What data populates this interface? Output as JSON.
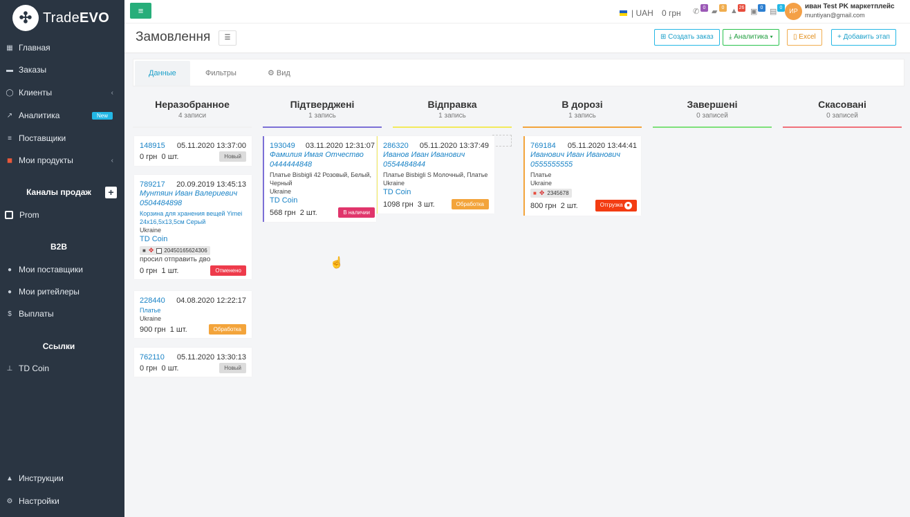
{
  "app": {
    "logo_glyph": "✣",
    "logo_text_1": "Trade",
    "logo_text_2": "EVO"
  },
  "sidebar": {
    "items": [
      {
        "label": "Главная",
        "icon": "dashboard-icon"
      },
      {
        "label": "Заказы",
        "icon": "truck-icon"
      },
      {
        "label": "Клиенты",
        "icon": "user-icon"
      },
      {
        "label": "Аналитика",
        "icon": "chart-icon",
        "badge": "New"
      },
      {
        "label": "Поставщики",
        "icon": "list-icon"
      },
      {
        "label": "Мои продукты",
        "icon": "box-icon"
      }
    ],
    "sales_channels_heading": "Каналы продаж",
    "prom_label": "Prom",
    "b2b_heading": "B2B",
    "b2b_items": [
      {
        "label": "Мои поставщики"
      },
      {
        "label": "Мои ритейлеры"
      },
      {
        "label": "Выплаты"
      }
    ],
    "links_heading": "Ссылки",
    "td_coin_label": "TD Coin",
    "instructions_label": "Инструкции",
    "settings_label": "Настройки"
  },
  "topbar": {
    "currency": "| UAH",
    "balance": "0 грн",
    "counters": [
      {
        "icon": "phone-icon",
        "count": "0",
        "color": "#9b59b6"
      },
      {
        "icon": "chat-icon",
        "count": "0",
        "color": "#f0ad4e"
      },
      {
        "icon": "bell-icon",
        "count": "26",
        "color": "#e74c3c"
      },
      {
        "icon": "bag-icon",
        "count": "0",
        "color": "#2c7fd1"
      },
      {
        "icon": "cart-icon",
        "count": "0",
        "color": "#23b7e5"
      }
    ],
    "avatar_initials": "ИР",
    "user_name": "иван Test PK маркетплейс",
    "user_email": "muntiyan@gmail.com"
  },
  "header": {
    "title": "Замовлення",
    "create_order": "Создать заказ",
    "analytics": "Аналитика",
    "excel": "Excel",
    "add_stage": "Добавить этап"
  },
  "tabs": {
    "data": "Данные",
    "filters": "Фильтры",
    "view": "Вид"
  },
  "columns": [
    {
      "title": "Неразобранное",
      "count": "4 записи",
      "color": "#f1f1f1"
    },
    {
      "title": "Підтверджені",
      "count": "1 запись",
      "color": "#7b6fd6"
    },
    {
      "title": "Відправка",
      "count": "1 запись",
      "color": "#f3ea5b"
    },
    {
      "title": "В дорозі",
      "count": "1 запись",
      "color": "#f3a43b"
    },
    {
      "title": "Завершені",
      "count": "0 записей",
      "color": "#7ee07a"
    },
    {
      "title": "Скасовані",
      "count": "0 записей",
      "color": "#f0707a"
    }
  ],
  "cards": {
    "c148915": {
      "id": "148915",
      "date": "05.11.2020 13:37:00",
      "sum": "0 грн",
      "qty": "0 шт.",
      "status": "Новый"
    },
    "c789217": {
      "id": "789217",
      "date": "20.09.2019 13:45:13",
      "name": "Мунтяин Иван Валериевич",
      "phone": "0504484898",
      "product": "Корзина для хранения вещей Yimei 24х16,5х13,5см Серый",
      "country": "Ukraine",
      "shop": "TD Coin",
      "ttn": "20450165624306",
      "comment": "просил отправить дво",
      "sum": "0 грн",
      "qty": "1 шт.",
      "status": "Отменено"
    },
    "c228440": {
      "id": "228440",
      "date": "04.08.2020 12:22:17",
      "product": "Платье",
      "country": "Ukraine",
      "sum": "900 грн",
      "qty": "1 шт.",
      "status": "Обработка"
    },
    "c762110": {
      "id": "762110",
      "date": "05.11.2020 13:30:13",
      "sum": "0 грн",
      "qty": "0 шт.",
      "status": "Новый"
    },
    "c193049": {
      "id": "193049",
      "date": "03.11.2020 12:31:07",
      "name": "Фамилия Имая Отчество",
      "phone": "0444444848",
      "product": "Платье Bisbigli 42 Розовый, Белый, Черный",
      "country": "Ukraine",
      "shop": "TD Coin",
      "sum": "568 грн",
      "qty": "2 шт.",
      "status": "В наличии"
    },
    "c286320": {
      "id": "286320",
      "date": "05.11.2020 13:37:49",
      "name": "Иванов Иван Иванович",
      "phone": "0554484844",
      "product": "Платье Bisbigli S Молочный, Платье",
      "country": "Ukraine",
      "shop": "TD Coin",
      "sum": "1098 грн",
      "qty": "3 шт.",
      "status": "Обработка"
    },
    "c769184": {
      "id": "769184",
      "date": "05.11.2020 13:44:41",
      "name": "Иванович Иван Иванович",
      "phone": "0555555555",
      "product": "Платье",
      "country": "Ukraine",
      "ttn": "2345678",
      "sum": "800 грн",
      "qty": "2 шт.",
      "status": "Отгрузка"
    }
  }
}
